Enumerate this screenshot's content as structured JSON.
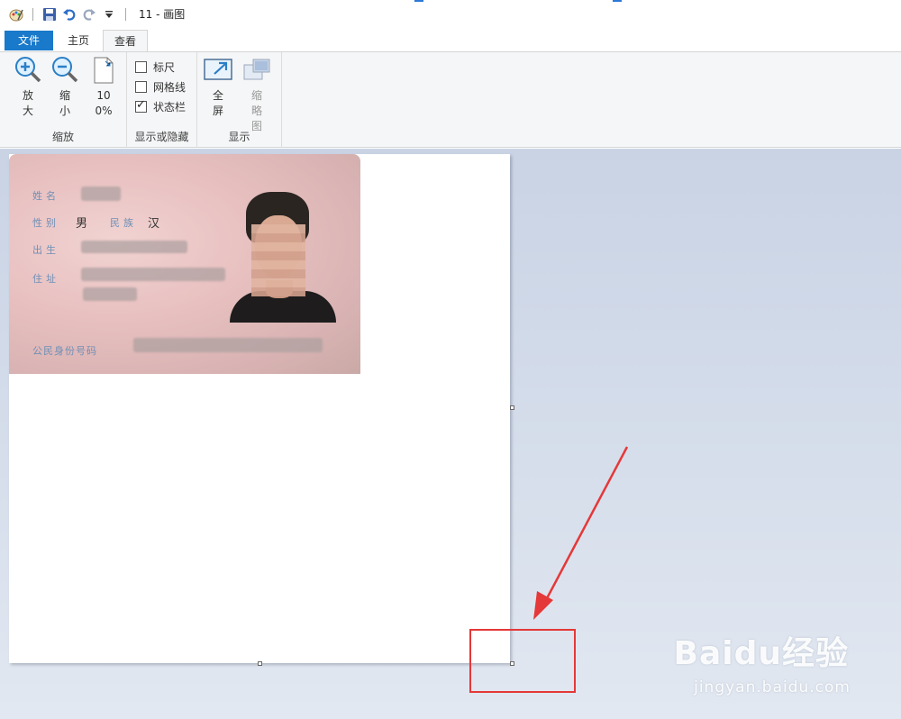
{
  "window": {
    "title": "11 - 画图"
  },
  "quick_access": {
    "icons": [
      "paint-app-icon",
      "save-icon",
      "undo-icon",
      "redo-icon",
      "customize-dropdown-icon"
    ]
  },
  "tabs": {
    "file": "文件",
    "home": "主页",
    "view": "查看"
  },
  "ribbon": {
    "zoom_group": {
      "label": "缩放",
      "zoom_in": "放大",
      "zoom_out": "缩小",
      "hundred": "100%"
    },
    "show_hide_group": {
      "label": "显示或隐藏",
      "rulers": {
        "label": "标尺",
        "checked": false
      },
      "gridlines": {
        "label": "网格线",
        "checked": false
      },
      "status_bar": {
        "label": "状态栏",
        "checked": true
      }
    },
    "display_group": {
      "label": "显示",
      "full_screen": "全屏",
      "thumbnail": "缩略图"
    }
  },
  "id_card": {
    "name_label": "姓名",
    "gender_label": "性别",
    "gender_value": "男",
    "ethnicity_label": "民族",
    "ethnicity_value": "汉",
    "birth_label": "出生",
    "address_label": "住址",
    "id_label": "公民身份号码"
  },
  "watermark": {
    "brand": "Baidu经验",
    "url": "jingyan.baidu.com"
  },
  "colors": {
    "accent": "#1979ca",
    "annotation": "#e53838"
  }
}
